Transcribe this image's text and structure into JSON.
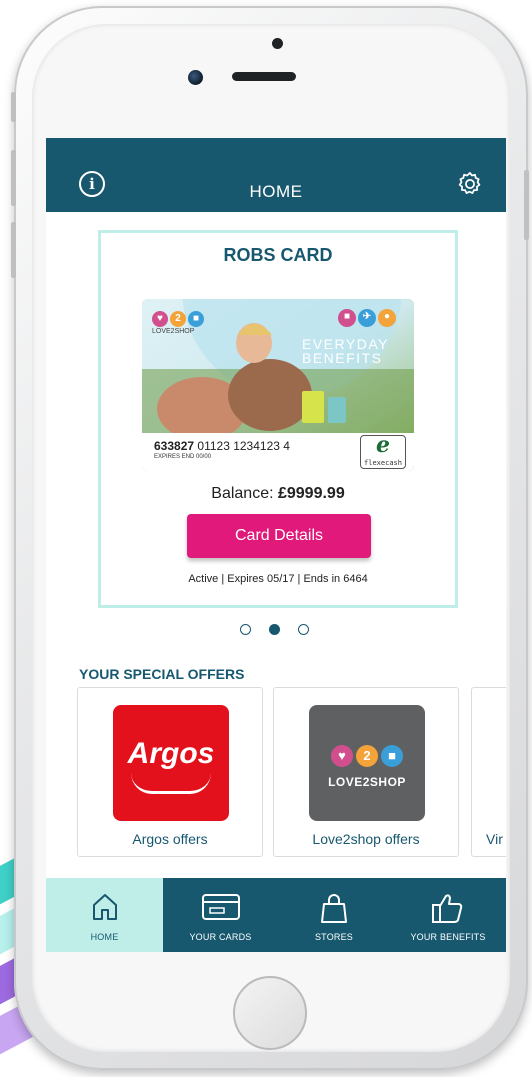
{
  "header": {
    "title": "HOME",
    "info_icon": "info-icon",
    "settings_icon": "gear-icon"
  },
  "card": {
    "title": "ROBS CARD",
    "brand": "LOVE2SHOP",
    "tagline_line1": "EVERYDAY",
    "tagline_line2": "BENEFITS",
    "number_prefix": "633827",
    "number_rest": "01123 1234123 4",
    "expires_small": "EXPIRES END 00/00",
    "flexecash_logo_letter": "e",
    "flexecash_logo_text": "flexecash",
    "balance_label": "Balance:",
    "balance_value": "£9999.99",
    "details_button": "Card Details",
    "status_line": "Active | Expires 05/17 | Ends in 6464"
  },
  "pager": {
    "count": 3,
    "active_index": 1
  },
  "offers": {
    "title": "YOUR SPECIAL OFFERS",
    "items": [
      {
        "label": "Argos offers",
        "logo_text": "Argos"
      },
      {
        "label": "Love2shop offers",
        "logo_text": "LOVE2SHOP",
        "logo_num": "2"
      },
      {
        "label": "Vir"
      }
    ]
  },
  "tabs": [
    {
      "label": "HOME",
      "icon": "home-icon",
      "active": true
    },
    {
      "label": "YOUR CARDS",
      "icon": "card-icon",
      "active": false
    },
    {
      "label": "STORES",
      "icon": "shopping-bag-icon",
      "active": false
    },
    {
      "label": "YOUR BENEFITS",
      "icon": "thumbs-up-icon",
      "active": false
    }
  ],
  "colors": {
    "primary": "#17586f",
    "accent": "#e0197a",
    "highlight": "#bfeee9",
    "argos_red": "#e3111c",
    "l2s_grey": "#5f6062"
  }
}
